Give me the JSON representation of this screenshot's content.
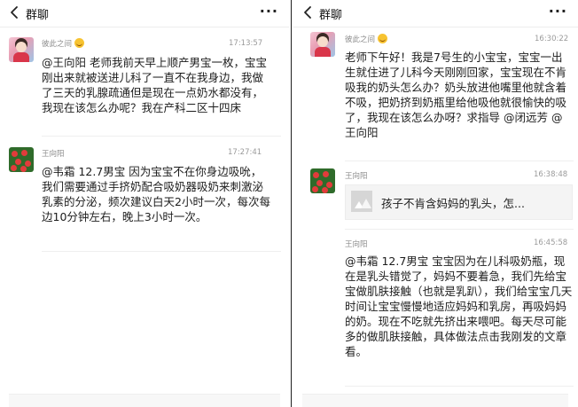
{
  "left": {
    "title": "群聊",
    "more": "···",
    "messages": [
      {
        "sender": "彼此之间",
        "time": "17:13:57",
        "text": "@王向阳 老师我前天早上顺产男宝一枚，宝宝刚出来就被送进儿科了一直不在我身边，我做了三天的乳腺疏通但是现在一点奶水都没有，我现在该怎么办呢？我在产科二区十四床"
      },
      {
        "sender": "王向阳",
        "time": "17:27:41",
        "text": "@韦霜  12.7男宝 因为宝宝不在你身边吸吮，我们需要通过手挤奶配合吸奶器吸奶来刺激泌乳素的分泌，频次建议白天2小时一次，每次每边10分钟左右，晚上3小时一次。"
      }
    ]
  },
  "right": {
    "title": "群聊",
    "more": "···",
    "messages": [
      {
        "sender": "彼此之间",
        "time": "16:30:22",
        "text": "老师下午好！我是7号生的小宝宝，宝宝一出生就住进了儿科今天刚刚回家，宝宝现在不肯吸我的奶头怎么办？奶头放进他嘴里他就含着不吸，把奶挤到奶瓶里给他吸他就很愉快的吸了，我现在该怎么办呀？求指导 @闭远芳 @王向阳"
      },
      {
        "sender": "王向阳",
        "time": "16:38:48",
        "link_title": "孩子不肯含妈妈的乳头，怎..."
      },
      {
        "sender": "王向阳",
        "time": "16:45:58",
        "text": "@韦霜  12.7男宝 宝宝因为在儿科吸奶瓶，现在是乳头错觉了，妈妈不要着急，我们先给宝宝做肌肤接触（也就是乳趴），我们给宝宝几天时间让宝宝慢慢地适应妈妈和乳房，再吸妈妈的奶。现在不吃就先挤出来喂吧。每天尽可能多的做肌肤接触，具体做法点击我刚发的文章看。"
      }
    ]
  }
}
